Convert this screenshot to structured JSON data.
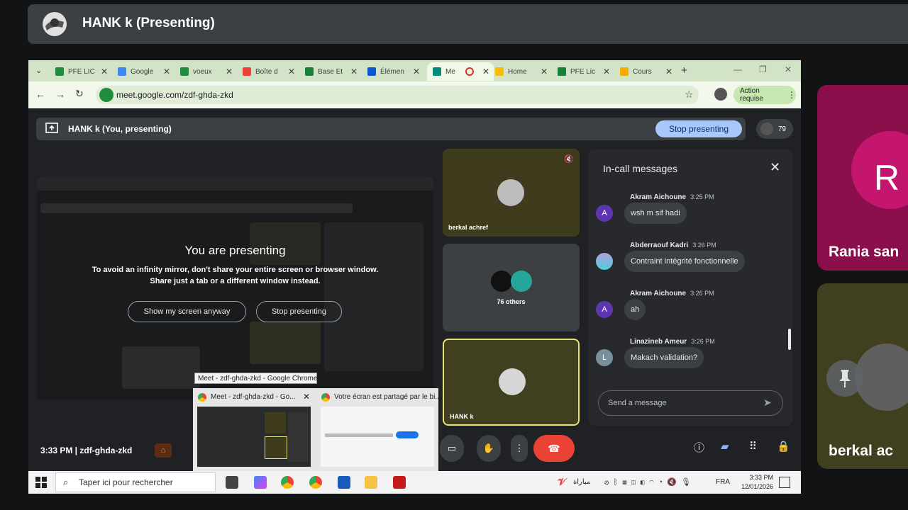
{
  "presenter_bar": {
    "title": "HANK k (Presenting)"
  },
  "right_tiles": {
    "rania": {
      "letter": "R",
      "name": "Rania san"
    },
    "berkal": {
      "name": "berkal ac"
    }
  },
  "browser": {
    "tabs": [
      {
        "label": "PFE LIC",
        "color": "#1e8e3e"
      },
      {
        "label": "Google",
        "color": "#4285f4"
      },
      {
        "label": "voeux",
        "color": "#1e8e3e"
      },
      {
        "label": "Boîte d",
        "color": "#ea4335"
      },
      {
        "label": "Base Et",
        "color": "#188038"
      },
      {
        "label": "Élémen",
        "color": "#0b57d0"
      },
      {
        "label": "Me",
        "color": "#00897b"
      },
      {
        "label": "Home",
        "color": "#fbbc04"
      },
      {
        "label": "PFE Lic",
        "color": "#188038"
      },
      {
        "label": "Cours",
        "color": "#f9ab00"
      }
    ],
    "url": "meet.google.com/zdf-ghda-zkd",
    "action_required": "Action requise"
  },
  "meet": {
    "present_label": "HANK k (You, presenting)",
    "stop_presenting": "Stop presenting",
    "participant_count": "79",
    "self_preview": {
      "title": "You are presenting",
      "line1": "To avoid an infinity mirror, don't share your entire screen or browser window.",
      "line2": "Share just a tab or a different window instead.",
      "show_anyway": "Show my screen anyway",
      "stop": "Stop presenting"
    },
    "tiles": [
      {
        "name": "berkal achref"
      },
      {
        "name": "76 others"
      },
      {
        "name": "HANK k"
      }
    ],
    "chat": {
      "title": "In-call messages",
      "messages": [
        {
          "initial": "A",
          "sender": "Akram Aichoune",
          "time": "3:25 PM",
          "text": "wsh m sif hadi",
          "color": "#5e35b1"
        },
        {
          "initial": "",
          "sender": "Abderraouf Kadri",
          "time": "3:26 PM",
          "text": "Contraint intégrité fonctionnelle",
          "color": "#80deea"
        },
        {
          "initial": "A",
          "sender": "Akram Aichoune",
          "time": "3:26 PM",
          "text": "ah",
          "color": "#5e35b1"
        },
        {
          "initial": "L",
          "sender": "Linazineb Ameur",
          "time": "3:26 PM",
          "text": "Makach validation?",
          "color": "#78909c"
        }
      ],
      "input_placeholder": "Send a message"
    },
    "meeting_info": "3:33 PM  |  zdf-ghda-zkd"
  },
  "taskbar": {
    "search_placeholder": "Taper ici pour rechercher",
    "weather": "مباراة",
    "lang": "FRA",
    "time": "3:33 PM",
    "date": "12/01/2026",
    "thumb_tooltip": "Meet - zdf-ghda-zkd - Google Chrome",
    "thumb1_title": "Meet - zdf-ghda-zkd - Go...",
    "thumb2_title": "Votre écran est partagé par le bi..."
  }
}
